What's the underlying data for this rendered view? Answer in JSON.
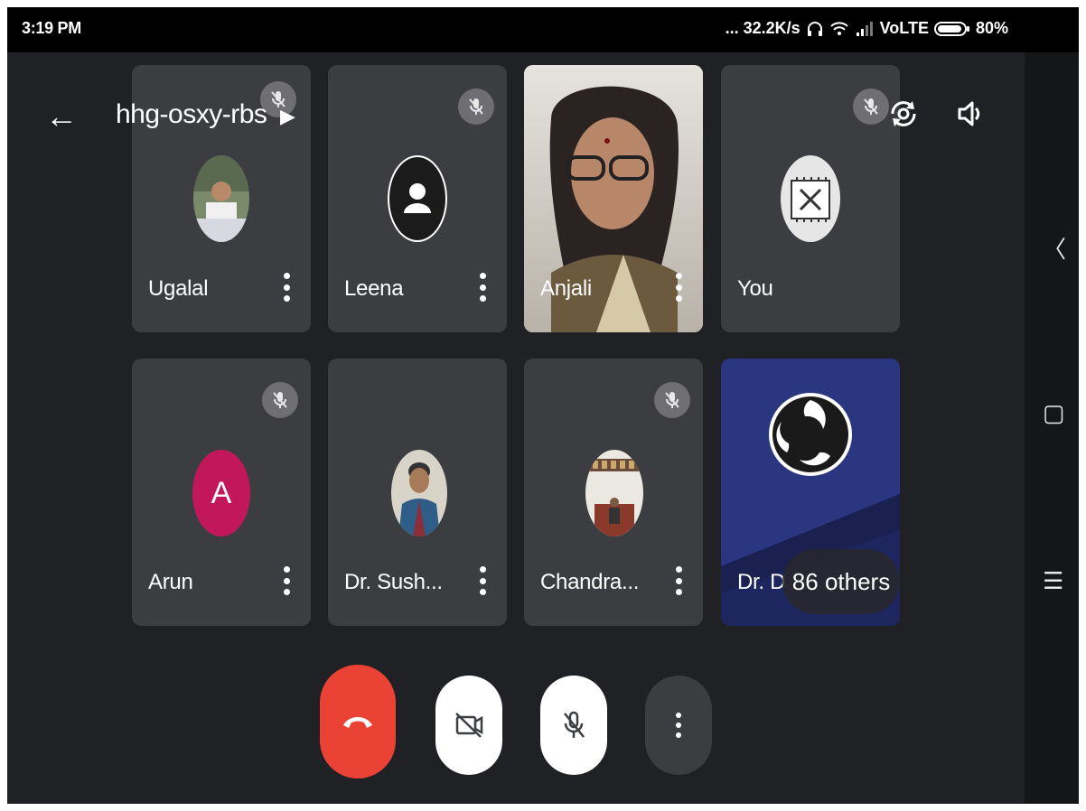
{
  "status_bar": {
    "time": "3:19 PM",
    "network_speed": "... 32.2K/s",
    "network_type": "VoLTE",
    "battery": "80%"
  },
  "header": {
    "meeting_code": "hhg-osxy-rbs",
    "icons": [
      "back-arrow-icon",
      "chevron-right-icon",
      "switch-camera-icon",
      "speaker-icon"
    ]
  },
  "participants": [
    {
      "name": "Ugalal",
      "muted": true,
      "avatar": "photo"
    },
    {
      "name": "Leena",
      "muted": true,
      "avatar": "default-person"
    },
    {
      "name": "Anjali",
      "muted": false,
      "avatar": "video"
    },
    {
      "name": "You",
      "muted": true,
      "avatar": "chip-image"
    },
    {
      "name": "Arun",
      "muted": true,
      "avatar": "initial",
      "initial": "A"
    },
    {
      "name": "Dr. Sush...",
      "muted": false,
      "avatar": "photo"
    },
    {
      "name": "Chandra...",
      "muted": true,
      "avatar": "photo"
    },
    {
      "name": "Dr. D",
      "muted": false,
      "avatar": "obs-logo"
    }
  ],
  "others_pill": "86 others",
  "controls": {
    "end_call": "end-call-icon",
    "camera": "camera-off-icon",
    "mic": "mic-off-icon",
    "more": "more-vert-icon"
  },
  "colors": {
    "background": "#202124",
    "tile": "#3c3d41",
    "end_call_red": "#ea4335",
    "arun_avatar": "#c2185b"
  }
}
